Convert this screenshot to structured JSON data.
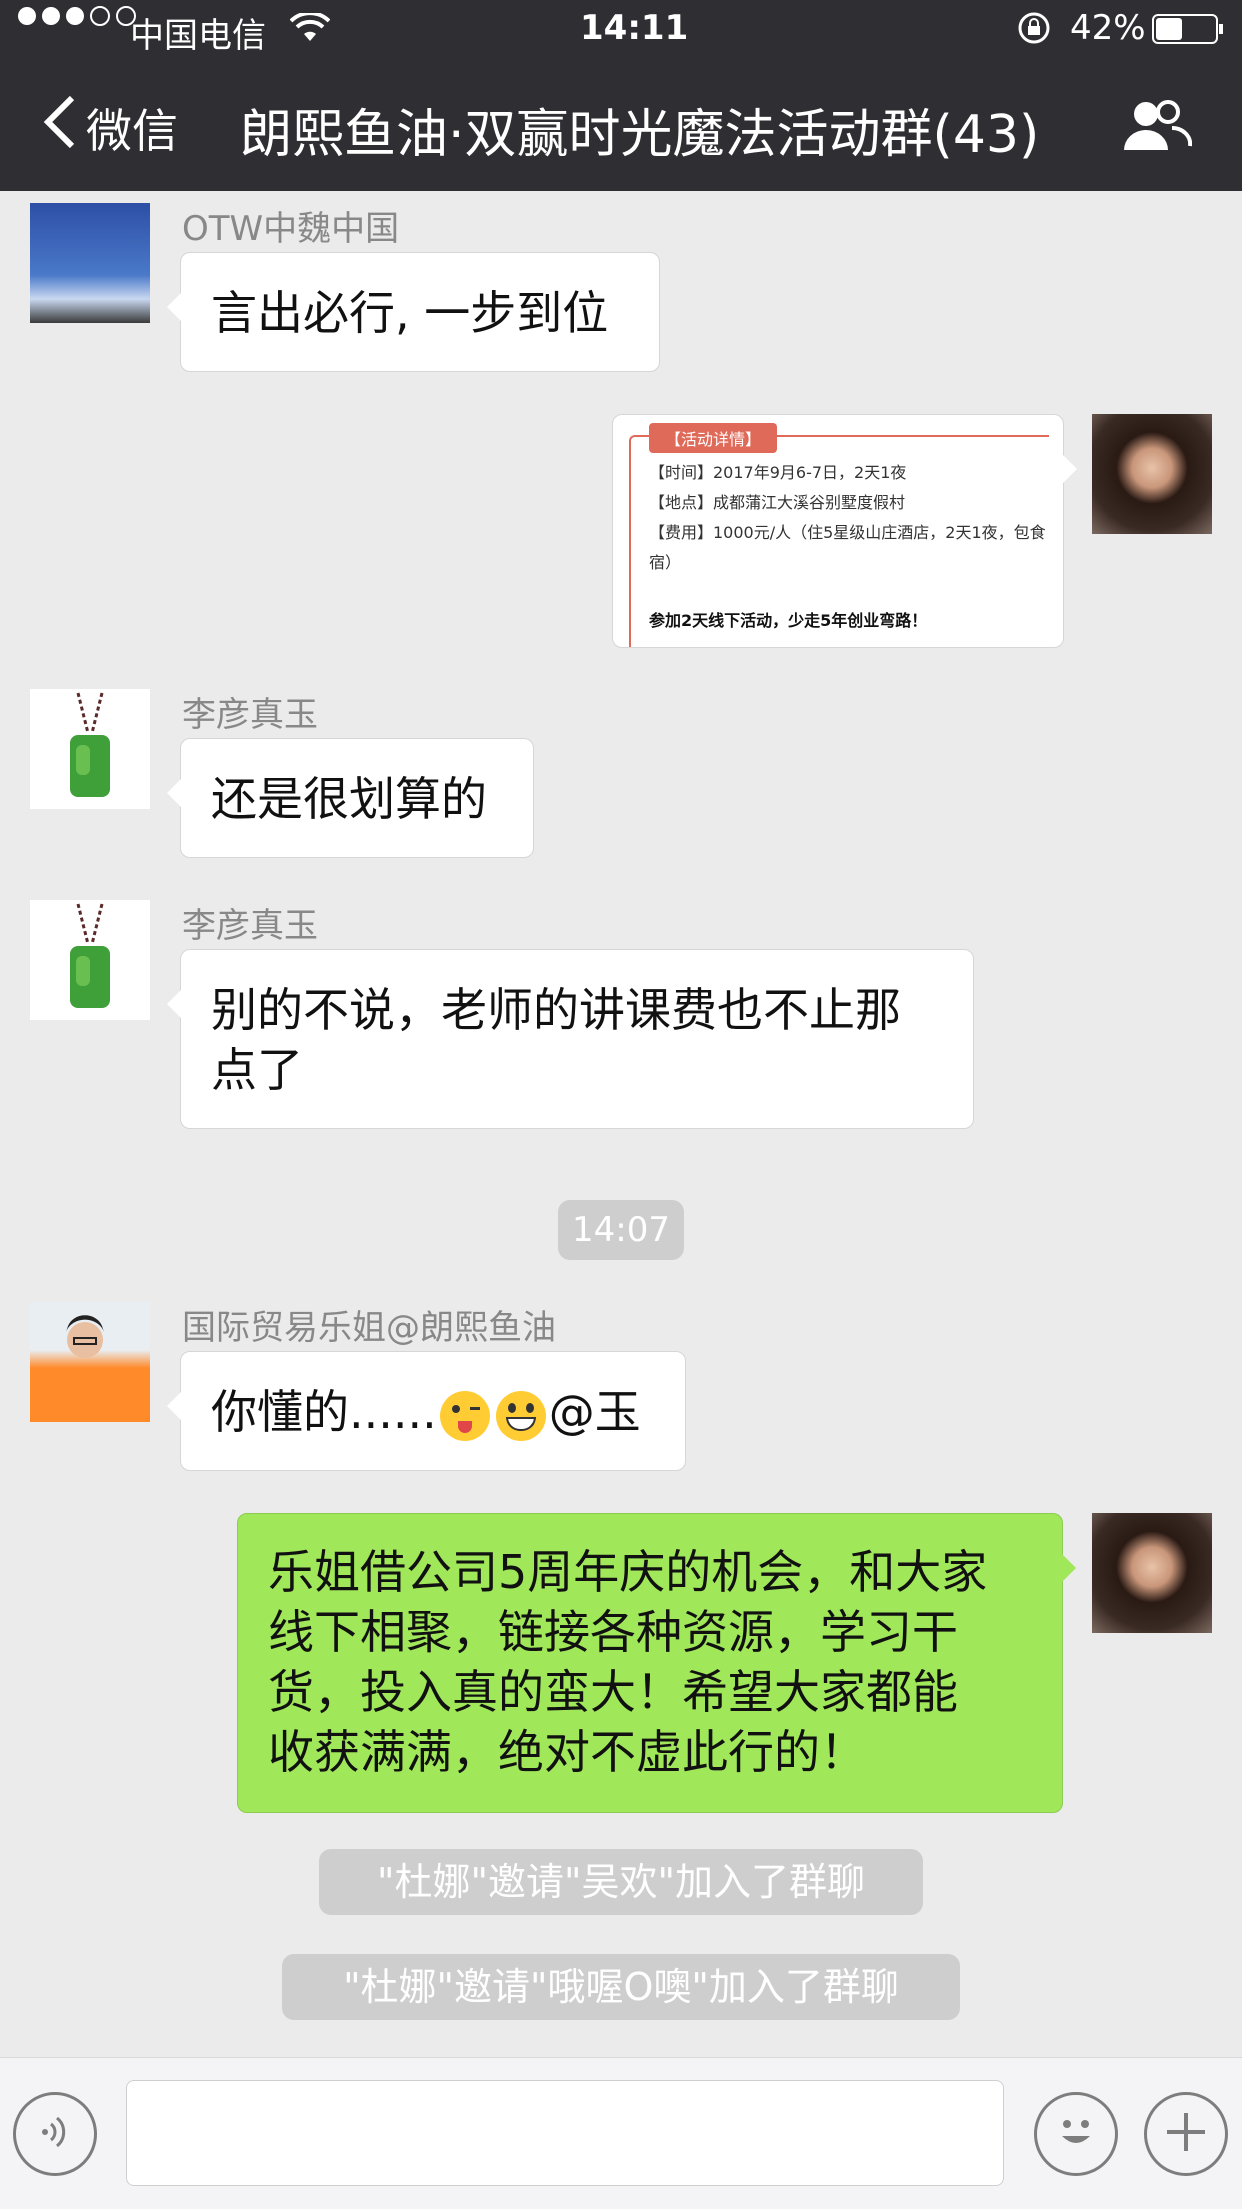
{
  "status_bar": {
    "carrier": "中国电信",
    "time": "14:11",
    "battery": "42%"
  },
  "nav": {
    "back_label": "微信",
    "title": "朗熙鱼油·双赢时光魔法活动群(43)"
  },
  "messages": {
    "m1": {
      "sender": "OTW中魏中国",
      "text": "言出必行, 一步到位"
    },
    "m2": {
      "badge": "【活动详情】",
      "time_line": "【时间】2017年9月6-7日，2天1夜",
      "place_line": "【地点】成都蒲江大溪谷别墅度假村",
      "fee_line1": "【费用】1000元/人（住5星级山庄酒店，2天1夜，包食",
      "fee_line2": "宿）",
      "bold_line": "参加2天线下活动，少走5年创业弯路！"
    },
    "m3": {
      "sender": "李彦真玉",
      "text": "还是很划算的"
    },
    "m4": {
      "sender": "李彦真玉",
      "line1": "别的不说，老师的讲课费也不止那",
      "line2": "点了"
    },
    "timestamp": "14:07",
    "m5": {
      "sender": "国际贸易乐姐@朗熙鱼油",
      "text_pre": "你懂的......",
      "text_post": "@玉"
    },
    "m6": {
      "line1": "乐姐借公司5周年庆的机会，和大家",
      "line2": "线下相聚，链接各种资源，学习干",
      "line3": "货，投入真的蛮大！希望大家都能",
      "line4": "收获满满，绝对不虚此行的！"
    },
    "sys1": "\"杜娜\"邀请\"吴欢\"加入了群聊",
    "sys2": "\"杜娜\"邀请\"哦喔O噢\"加入了群聊"
  },
  "colors": {
    "nav_bg": "#2e2e33",
    "chat_bg": "#ebebeb",
    "green_bubble": "#a0e75a",
    "badge_red": "#e06a5a"
  },
  "icons": [
    "signal-dots-icon",
    "wifi-icon",
    "rotation-lock-icon",
    "battery-icon",
    "back-chevron-icon",
    "group-members-icon",
    "voice-icon",
    "emoji-icon",
    "plus-icon",
    "winking-tongue-emoji",
    "grinning-emoji"
  ]
}
